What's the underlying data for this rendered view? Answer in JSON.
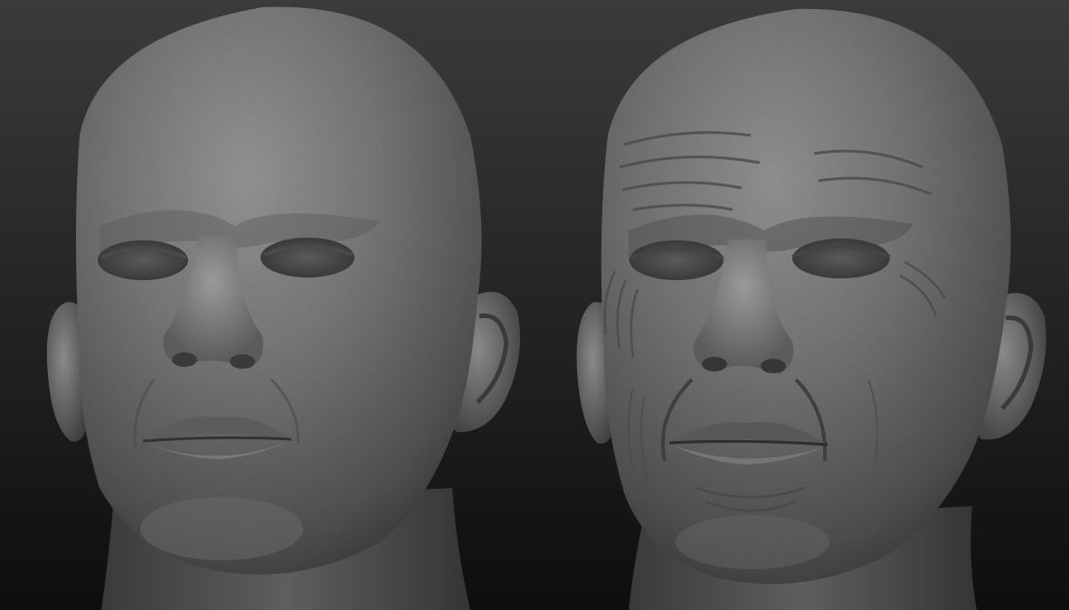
{
  "scene": {
    "background_top": "#3a3a3a",
    "background_bottom": "#0d0d0d",
    "clay_light": "#9a9a9a",
    "clay_mid": "#6f6f6f",
    "clay_dark": "#3c3c3c",
    "subjects": [
      {
        "name": "smooth-head",
        "detail": "smooth"
      },
      {
        "name": "aged-head",
        "detail": "wrinkled"
      }
    ]
  }
}
